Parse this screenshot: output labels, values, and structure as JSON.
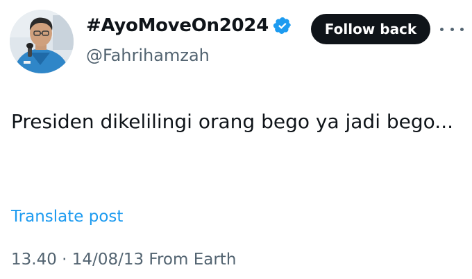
{
  "post": {
    "author": {
      "display_name": "#AyoMoveOn2024",
      "handle": "@Fahrihamzah",
      "verified": true,
      "avatar": "profile-photo"
    },
    "follow_button_label": "Follow back",
    "more_icon": "ellipsis-icon",
    "text": "Presiden dikelilingi orang bego ya jadi bego...",
    "translate_label": "Translate post",
    "time": "13.40",
    "separator": "·",
    "date": "14/08/13",
    "source": "From Earth"
  },
  "colors": {
    "text_primary": "#0f1419",
    "text_secondary": "#536471",
    "link": "#1d9bf0",
    "verified_badge": "#1d9bf0",
    "button_bg": "#0f1419",
    "button_text": "#ffffff"
  }
}
